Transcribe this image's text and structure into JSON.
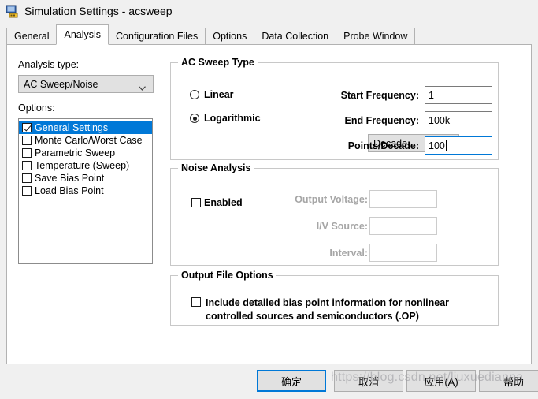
{
  "window": {
    "title": "Simulation Settings - acsweep",
    "icon": "simulation-profile-icon"
  },
  "tabs": [
    {
      "label": "General",
      "active": false
    },
    {
      "label": "Analysis",
      "active": true
    },
    {
      "label": "Configuration Files",
      "active": false
    },
    {
      "label": "Options",
      "active": false
    },
    {
      "label": "Data Collection",
      "active": false
    },
    {
      "label": "Probe Window",
      "active": false
    }
  ],
  "left_panel": {
    "analysis_type_label": "Analysis type:",
    "analysis_type_value": "AC Sweep/Noise",
    "options_label": "Options:",
    "options": [
      {
        "label": "General Settings",
        "checked": true,
        "selected": true
      },
      {
        "label": "Monte Carlo/Worst Case",
        "checked": false,
        "selected": false
      },
      {
        "label": "Parametric Sweep",
        "checked": false,
        "selected": false
      },
      {
        "label": "Temperature (Sweep)",
        "checked": false,
        "selected": false
      },
      {
        "label": "Save Bias Point",
        "checked": false,
        "selected": false
      },
      {
        "label": "Load Bias Point",
        "checked": false,
        "selected": false
      }
    ]
  },
  "ac_sweep_type": {
    "group_title": "AC Sweep Type",
    "linear_label": "Linear",
    "logarithmic_label": "Logarithmic",
    "selected_sweep": "Logarithmic",
    "scale_value": "Decade",
    "start_frequency_label": "Start Frequency:",
    "start_frequency_value": "1",
    "end_frequency_label": "End Frequency:",
    "end_frequency_value": "100k",
    "points_label": "Points/Decade:",
    "points_value": "100"
  },
  "noise_analysis": {
    "group_title": "Noise Analysis",
    "enabled_label": "Enabled",
    "enabled": false,
    "output_voltage_label": "Output Voltage:",
    "output_voltage_value": "",
    "iv_source_label": "I/V Source:",
    "iv_source_value": "",
    "interval_label": "Interval:",
    "interval_value": ""
  },
  "output_file_options": {
    "group_title": "Output File Options",
    "include_bias_label": "Include detailed bias point information for nonlinear controlled sources and semiconductors (.OP)",
    "include_bias_checked": false
  },
  "footer": {
    "ok_label": "确定",
    "cancel_label": "取消",
    "apply_label": "应用(A)",
    "help_label": "帮助"
  },
  "watermark": {
    "text": "https://blog.csdn.net/liuxuedianna"
  },
  "colors": {
    "accent": "#0078d7",
    "dialog_bg": "#f0f0f0",
    "panel_bg": "#ffffff",
    "control_bg": "#e1e1e1",
    "disabled_text": "#a6a6a6"
  }
}
